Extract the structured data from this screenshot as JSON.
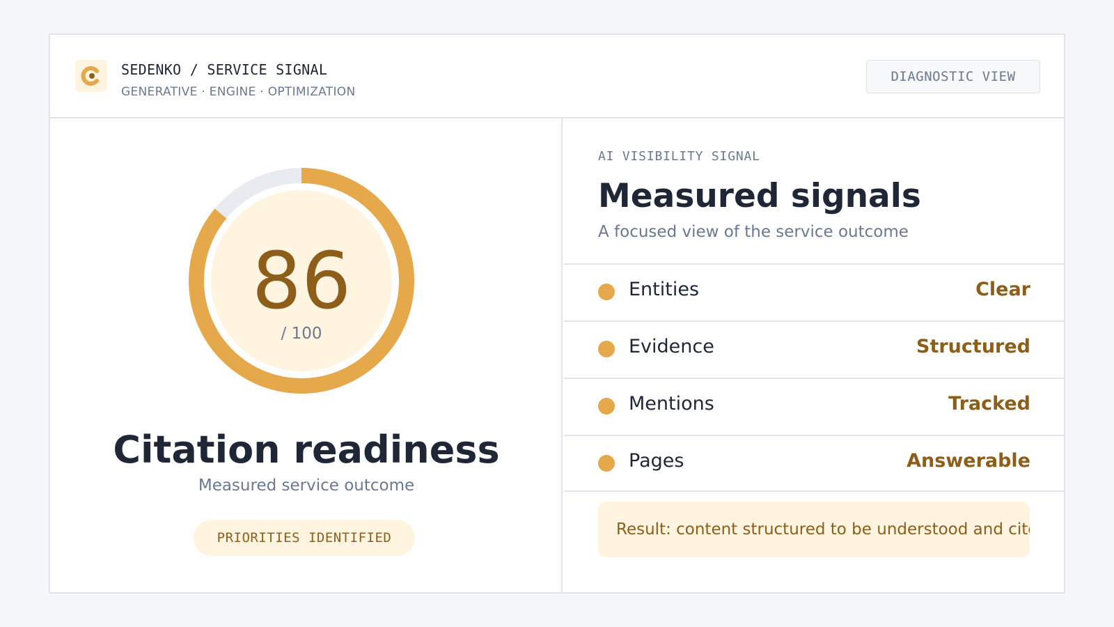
{
  "header": {
    "brand_title": "SEDENKO / SERVICE SIGNAL",
    "brand_subtitle": "GENERATIVE · ENGINE · OPTIMIZATION",
    "logo_icon": "c-mark-icon",
    "view_button": "DIAGNOSTIC VIEW"
  },
  "score_panel": {
    "score": "86",
    "score_max": "/ 100",
    "score_fraction": 0.86,
    "title": "Citation readiness",
    "subtitle": "Measured service outcome",
    "status_pill": "PRIORITIES IDENTIFIED"
  },
  "signals_panel": {
    "eyebrow": "AI VISIBILITY SIGNAL",
    "title": "Measured signals",
    "subtitle": "A focused view of the service outcome",
    "rows": [
      {
        "label": "Entities",
        "value": "Clear"
      },
      {
        "label": "Evidence",
        "value": "Structured"
      },
      {
        "label": "Mentions",
        "value": "Tracked"
      },
      {
        "label": "Pages",
        "value": "Answerable"
      }
    ],
    "result": "Result: content structured to be understood and cited by AI"
  },
  "colors": {
    "accent": "#e5a84b",
    "accent_dark": "#8c5e1a",
    "accent_light": "#fff4e0",
    "text": "#1f2636",
    "muted": "#6b7890",
    "track": "#e8ecf1",
    "border": "#e2e6ec"
  }
}
